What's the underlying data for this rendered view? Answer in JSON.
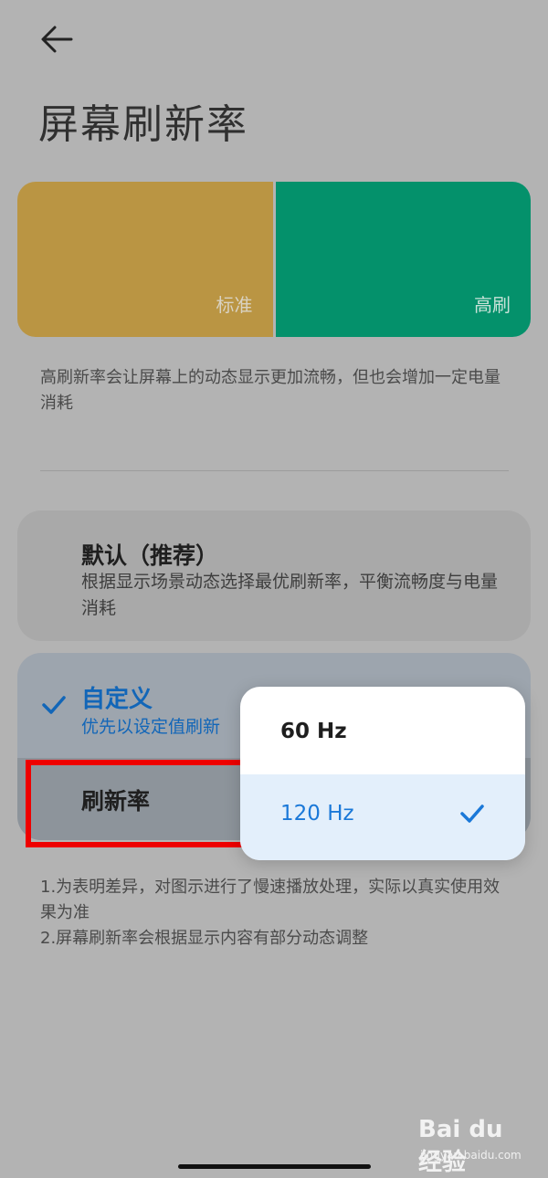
{
  "header": {
    "title": "屏幕刷新率"
  },
  "preview": {
    "standard_label": "标准",
    "high_label": "高刷",
    "standard_color": "#ba9543",
    "high_color": "#04916b"
  },
  "description": "高刷新率会让屏幕上的动态显示更加流畅，但也会增加一定电量消耗",
  "options": {
    "default": {
      "title": "默认（推荐）",
      "subtitle": "根据显示场景动态选择最优刷新率，平衡流畅度与电量消耗"
    },
    "custom": {
      "title": "自定义",
      "subtitle": "优先以设定值刷新",
      "selected": true,
      "refresh_rate_label": "刷新率"
    }
  },
  "popup": {
    "items": [
      {
        "label": "60 Hz",
        "selected": false
      },
      {
        "label": "120 Hz",
        "selected": true
      }
    ],
    "accent_color": "#1a78d8"
  },
  "notes": {
    "line1": "1.为表明差异，对图示进行了慢速播放处理，实际以真实使用效果为准",
    "line2": "2.屏幕刷新率会根据显示内容有部分动态调整"
  },
  "watermark": {
    "logo": "Bai du 经验",
    "site": "jingyan.baidu.com"
  }
}
